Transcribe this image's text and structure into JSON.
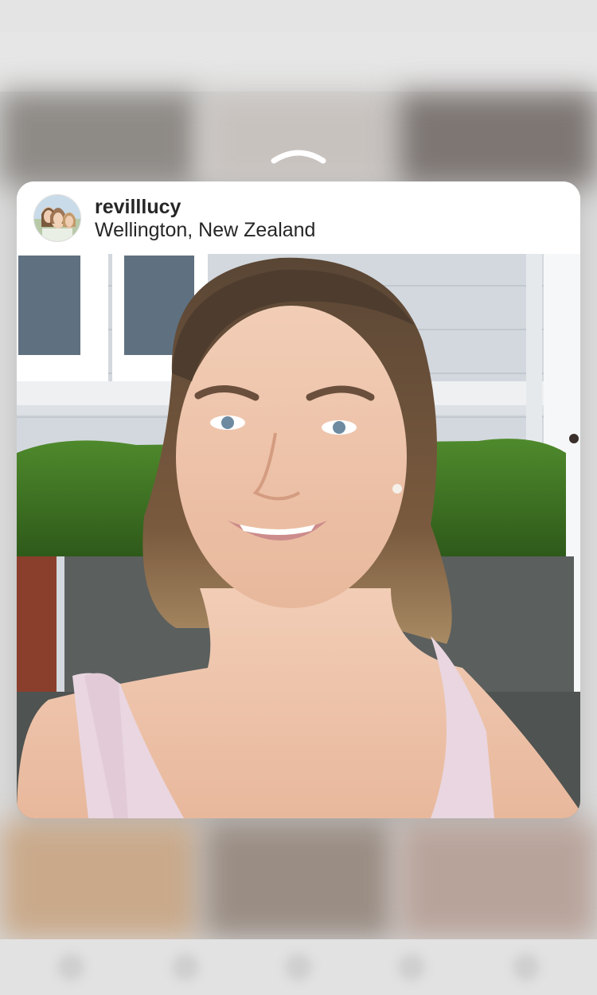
{
  "post_preview": {
    "username": "revilllucy",
    "location": "Wellington, New Zealand"
  },
  "icons": {
    "swipe_up": "chevron-up-icon"
  },
  "colors": {
    "card_bg": "#ffffff",
    "text": "#262626",
    "backdrop": "#d9d9d9"
  }
}
